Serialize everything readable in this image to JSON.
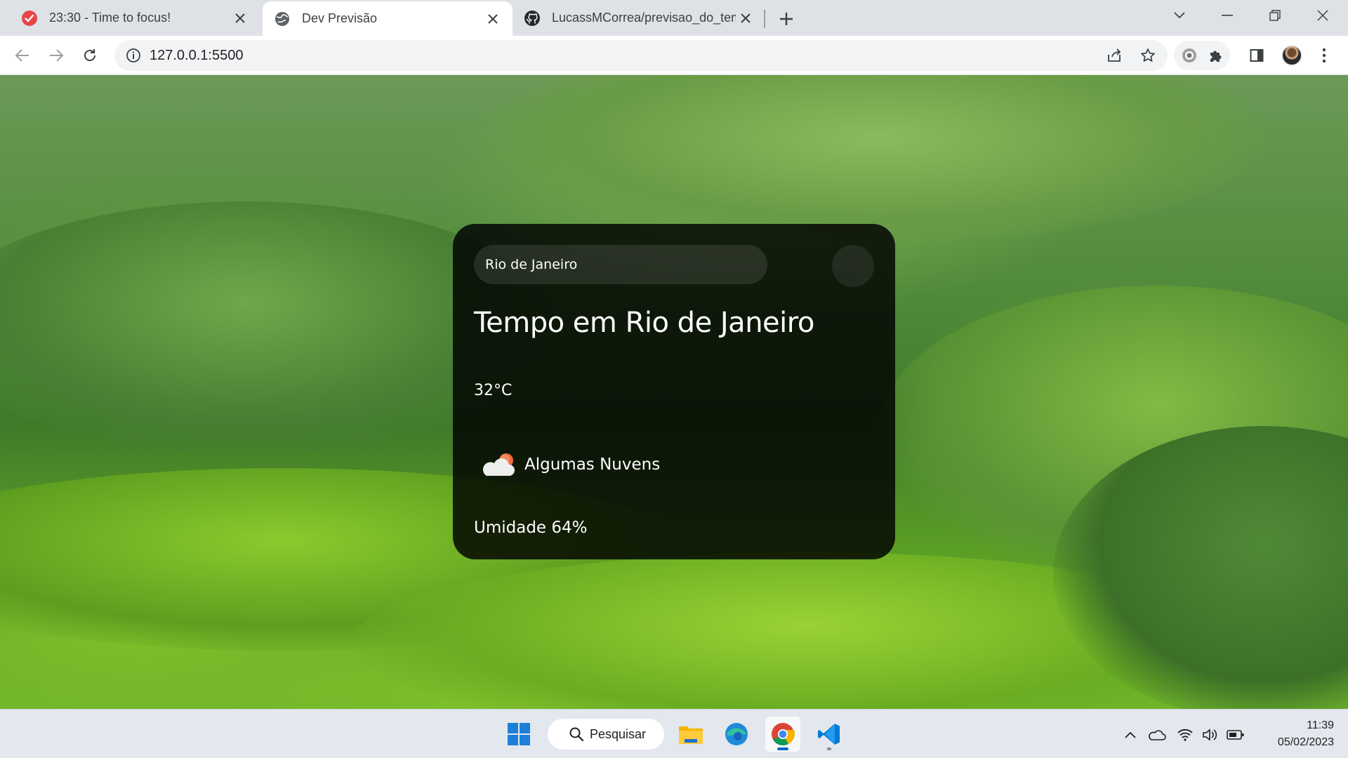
{
  "browser": {
    "tabs": [
      {
        "title": "23:30 - Time to focus!",
        "favicon": "check-circle-icon",
        "active": false
      },
      {
        "title": "Dev Previsão",
        "favicon": "globe-icon",
        "active": true
      },
      {
        "title": "LucassMCorrea/previsao_do_tem",
        "favicon": "github-icon",
        "active": false
      }
    ],
    "url": "127.0.0.1:5500"
  },
  "weather": {
    "search_value": "Rio de Janeiro",
    "title": "Tempo em Rio de Janeiro",
    "temperature": "32°C",
    "icon": "partly-cloudy-icon",
    "description": "Algumas Nuvens",
    "humidity": "Umidade 64%"
  },
  "taskbar": {
    "search_label": "Pesquisar",
    "time": "11:39",
    "date": "05/02/2023"
  },
  "colors": {
    "card_bg": "#000000",
    "active_indicator": "#0067c0"
  }
}
